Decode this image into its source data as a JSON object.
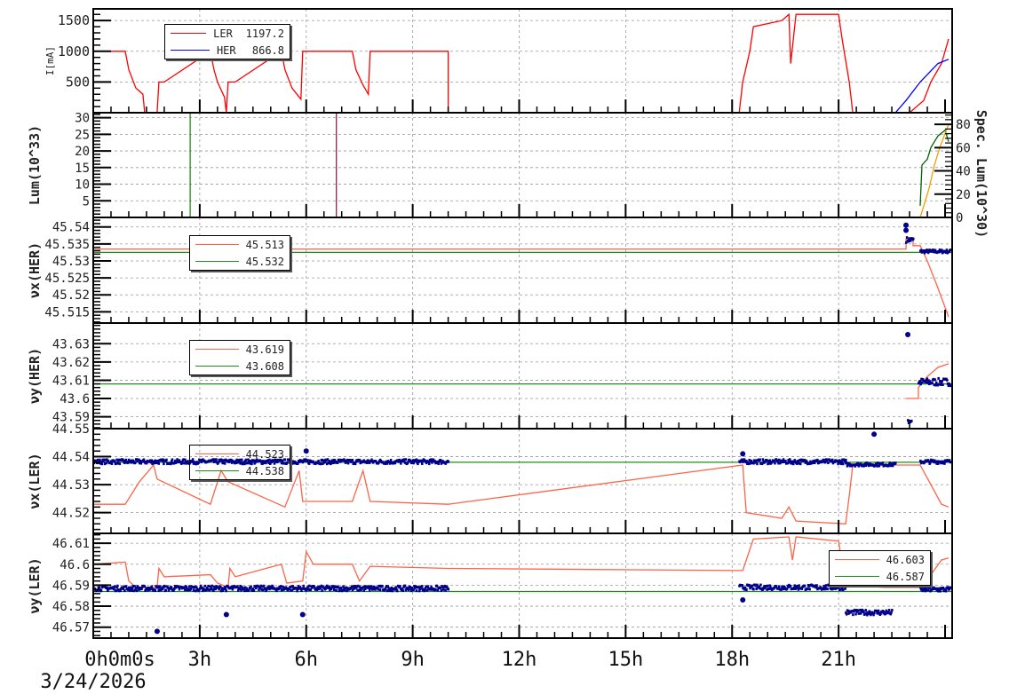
{
  "chart_data": [
    {
      "id": "current",
      "type": "line",
      "ylabel": "I[mA]",
      "ylim": [
        0,
        1690
      ],
      "yticks": [
        500,
        1000,
        1500
      ],
      "legend": [
        {
          "name": "LER",
          "value": "1197.2",
          "color": "#ff0000"
        },
        {
          "name": "HER",
          "value": "866.8",
          "color": "#0000ff"
        }
      ],
      "series": [
        {
          "name": "LER",
          "color": "#ff0000",
          "points": [
            [
              0,
              1000
            ],
            [
              0.9,
              1000
            ],
            [
              1.0,
              700
            ],
            [
              1.2,
              400
            ],
            [
              1.4,
              300
            ],
            [
              1.45,
              0
            ],
            [
              1.8,
              0
            ],
            [
              1.85,
              500
            ],
            [
              2.0,
              500
            ],
            [
              3.3,
              1000
            ],
            [
              3.4,
              700
            ],
            [
              3.5,
              500
            ],
            [
              3.7,
              250
            ],
            [
              3.75,
              0
            ],
            [
              3.8,
              500
            ],
            [
              4.0,
              500
            ],
            [
              5.3,
              1000
            ],
            [
              5.4,
              700
            ],
            [
              5.6,
              400
            ],
            [
              5.85,
              220
            ],
            [
              5.9,
              1000
            ],
            [
              7.3,
              1000
            ],
            [
              7.4,
              700
            ],
            [
              7.6,
              450
            ],
            [
              7.75,
              300
            ],
            [
              7.8,
              1000
            ],
            [
              10.0,
              1000
            ],
            [
              10.0,
              0
            ],
            [
              18.2,
              0
            ],
            [
              18.3,
              500
            ],
            [
              18.5,
              1000
            ],
            [
              18.6,
              1400
            ],
            [
              19.4,
              1500
            ],
            [
              19.6,
              1600
            ],
            [
              19.65,
              800
            ],
            [
              19.8,
              1600
            ],
            [
              21.0,
              1600
            ],
            [
              21.1,
              1200
            ],
            [
              21.3,
              500
            ],
            [
              21.4,
              0
            ],
            [
              23.0,
              0
            ],
            [
              23.4,
              200
            ],
            [
              23.6,
              500
            ],
            [
              23.9,
              800
            ],
            [
              24.1,
              1200
            ]
          ]
        },
        {
          "name": "HER",
          "color": "#0000ff",
          "points": [
            [
              0,
              0
            ],
            [
              22.6,
              0
            ],
            [
              22.9,
              200
            ],
            [
              23.3,
              500
            ],
            [
              23.8,
              800
            ],
            [
              24.1,
              870
            ]
          ]
        }
      ]
    },
    {
      "id": "lum",
      "type": "line",
      "ylabel": "Lum(10^33)",
      "ylim": [
        0,
        31.5
      ],
      "yticks": [
        5,
        10,
        15,
        20,
        25,
        30
      ],
      "y2label": "Spec. Lum(10^30)",
      "y2lim": [
        0,
        90
      ],
      "y2ticks": [
        0,
        20,
        40,
        60,
        80
      ],
      "series": [
        {
          "name": "Lum spike",
          "color": "#228b22",
          "points": [
            [
              2.73,
              0
            ],
            [
              2.73,
              31.5
            ]
          ]
        },
        {
          "name": "Lum spike 2",
          "color": "#8b2252",
          "points": [
            [
              6.85,
              0
            ],
            [
              6.85,
              31.5
            ]
          ]
        },
        {
          "name": "Spec lum HER",
          "axis": "y2",
          "color": "#006400",
          "points": [
            [
              23.3,
              10
            ],
            [
              23.35,
              45
            ],
            [
              23.5,
              50
            ],
            [
              23.6,
              60
            ],
            [
              23.8,
              70
            ],
            [
              24.0,
              75
            ],
            [
              24.1,
              65
            ]
          ]
        },
        {
          "name": "Spec lum LER",
          "axis": "y2",
          "color": "#f0a000",
          "points": [
            [
              23.3,
              0
            ],
            [
              23.4,
              10
            ],
            [
              23.55,
              25
            ],
            [
              23.7,
              45
            ],
            [
              23.85,
              60
            ],
            [
              24.0,
              72
            ],
            [
              24.1,
              80
            ]
          ]
        }
      ]
    },
    {
      "id": "nux_her",
      "type": "line",
      "ylabel": "νx(HER)",
      "ylim": [
        45.5117,
        45.5428
      ],
      "yticks": [
        45.515,
        45.52,
        45.525,
        45.53,
        45.535,
        45.54
      ],
      "legend": [
        {
          "value": "45.513",
          "color": "#ff6347"
        },
        {
          "value": "45.532",
          "color": "#228b22"
        }
      ],
      "series": [
        {
          "name": "set",
          "color": "#ff6347",
          "points": [
            [
              0,
              45.5335
            ],
            [
              22.9,
              45.5335
            ],
            [
              22.9,
              45.5365
            ],
            [
              23.1,
              45.5365
            ],
            [
              23.1,
              45.5345
            ],
            [
              23.3,
              45.5345
            ],
            [
              23.5,
              45.53
            ],
            [
              23.8,
              45.522
            ],
            [
              24.1,
              45.5135
            ]
          ]
        },
        {
          "name": "ref",
          "color": "#228b22",
          "points": [
            [
              0,
              45.5325
            ],
            [
              24.2,
              45.5325
            ]
          ]
        }
      ],
      "dots": [
        [
          22.9,
          23.1,
          45.5362,
          0.0008
        ],
        [
          23.3,
          24.15,
          45.5328,
          0.0005
        ]
      ],
      "extra_dots": [
        [
          22.9,
          45.5405
        ],
        [
          22.9,
          45.539
        ]
      ]
    },
    {
      "id": "nuy_her",
      "type": "line",
      "ylabel": "νy(HER)",
      "ylim": [
        43.5835,
        43.6413
      ],
      "yticks": [
        43.59,
        43.6,
        43.61,
        43.62,
        43.63
      ],
      "legend": [
        {
          "value": "43.619",
          "color": "#ff6347"
        },
        {
          "value": "43.608",
          "color": "#228b22"
        }
      ],
      "series": [
        {
          "name": "set",
          "color": "#ff6347",
          "points": [
            [
              22.9,
              43.6
            ],
            [
              23.25,
              43.6
            ],
            [
              23.25,
              43.606
            ],
            [
              23.5,
              43.612
            ],
            [
              23.8,
              43.617
            ],
            [
              24.1,
              43.619
            ]
          ]
        },
        {
          "name": "ref",
          "color": "#228b22",
          "points": [
            [
              0,
              43.608
            ],
            [
              24.2,
              43.608
            ]
          ]
        }
      ],
      "dots": [
        [
          22.95,
          23.05,
          43.588,
          0.002
        ],
        [
          23.25,
          24.15,
          43.609,
          0.002
        ]
      ],
      "extra_dots": [
        [
          22.95,
          43.635
        ]
      ]
    },
    {
      "id": "nux_ler",
      "type": "line",
      "ylabel": "νx(LER)",
      "ylim": [
        44.5126,
        44.55
      ],
      "yticks": [
        44.52,
        44.53,
        44.54,
        44.55
      ],
      "legend": [
        {
          "value": "44.523",
          "color": "#ff6347"
        },
        {
          "value": "44.538",
          "color": "#228b22"
        }
      ],
      "series": [
        {
          "name": "set",
          "color": "#ff6347",
          "points": [
            [
              0,
              44.523
            ],
            [
              0.9,
              44.523
            ],
            [
              1.3,
              44.531
            ],
            [
              1.7,
              44.537
            ],
            [
              1.8,
              44.532
            ],
            [
              3.3,
              44.523
            ],
            [
              3.6,
              44.535
            ],
            [
              3.8,
              44.531
            ],
            [
              5.4,
              44.522
            ],
            [
              5.8,
              44.535
            ],
            [
              5.9,
              44.524
            ],
            [
              7.3,
              44.524
            ],
            [
              7.6,
              44.535
            ],
            [
              7.8,
              44.524
            ],
            [
              10,
              44.523
            ],
            [
              18.3,
              44.537
            ],
            [
              18.4,
              44.52
            ],
            [
              19.4,
              44.518
            ],
            [
              19.6,
              44.522
            ],
            [
              19.8,
              44.517
            ],
            [
              21.2,
              44.516
            ],
            [
              21.3,
              44.526
            ],
            [
              21.4,
              44.537
            ],
            [
              23.3,
              44.537
            ],
            [
              23.6,
              44.53
            ],
            [
              23.9,
              44.523
            ],
            [
              24.1,
              44.522
            ]
          ]
        },
        {
          "name": "ref",
          "color": "#228b22",
          "points": [
            [
              0,
              44.538
            ],
            [
              24.2,
              44.538
            ]
          ]
        }
      ],
      "dots": [
        [
          0,
          10,
          44.5382,
          0.0008
        ],
        [
          18.2,
          21.2,
          44.5382,
          0.0008
        ],
        [
          21.2,
          22.6,
          44.5372,
          0.0006
        ],
        [
          23.3,
          24.15,
          44.5382,
          0.0007
        ]
      ],
      "extra_dots": [
        [
          6.0,
          44.542
        ],
        [
          18.3,
          44.541
        ],
        [
          22.0,
          44.548
        ]
      ]
    },
    {
      "id": "nuy_ler",
      "type": "line",
      "ylabel": "νy(LER)",
      "ylim": [
        46.5648,
        46.6147
      ],
      "yticks": [
        46.57,
        46.58,
        46.59,
        46.6,
        46.61
      ],
      "legend": [
        {
          "value": "46.603",
          "color": "#ff6347"
        },
        {
          "value": "46.587",
          "color": "#228b22"
        }
      ],
      "series": [
        {
          "name": "set",
          "color": "#ff6347",
          "points": [
            [
              0,
              46.6
            ],
            [
              0.9,
              46.601
            ],
            [
              1.0,
              46.592
            ],
            [
              1.2,
              46.589
            ],
            [
              1.8,
              46.589
            ],
            [
              1.85,
              46.598
            ],
            [
              2.0,
              46.594
            ],
            [
              3.3,
              46.595
            ],
            [
              3.5,
              46.591
            ],
            [
              3.8,
              46.589
            ],
            [
              3.85,
              46.598
            ],
            [
              4.0,
              46.594
            ],
            [
              5.3,
              46.6
            ],
            [
              5.45,
              46.591
            ],
            [
              5.9,
              46.592
            ],
            [
              6.0,
              46.606
            ],
            [
              6.2,
              46.6
            ],
            [
              7.3,
              46.6
            ],
            [
              7.5,
              46.592
            ],
            [
              7.8,
              46.599
            ],
            [
              10,
              46.598
            ],
            [
              18.3,
              46.597
            ],
            [
              18.6,
              46.612
            ],
            [
              19.6,
              46.613
            ],
            [
              19.7,
              46.602
            ],
            [
              19.8,
              46.613
            ],
            [
              21.0,
              46.611
            ],
            [
              21.2,
              46.59
            ],
            [
              22.3,
              46.589
            ],
            [
              23.3,
              46.589
            ],
            [
              23.6,
              46.595
            ],
            [
              23.9,
              46.602
            ],
            [
              24.1,
              46.603
            ]
          ]
        },
        {
          "name": "ref",
          "color": "#228b22",
          "points": [
            [
              0,
              46.587
            ],
            [
              24.2,
              46.587
            ]
          ]
        }
      ],
      "dots": [
        [
          0,
          10,
          46.5885,
          0.0012
        ],
        [
          18.2,
          21.2,
          46.589,
          0.0012
        ],
        [
          21.2,
          22.5,
          46.577,
          0.0012
        ],
        [
          23.3,
          24.15,
          46.588,
          0.0012
        ]
      ],
      "extra_dots": [
        [
          1.8,
          46.568
        ],
        [
          3.75,
          46.576
        ],
        [
          5.9,
          46.576
        ],
        [
          18.3,
          46.583
        ]
      ]
    }
  ],
  "xaxis": {
    "ticks": [
      0,
      3,
      6,
      9,
      12,
      15,
      18,
      21
    ],
    "labels": [
      "0h0m0s",
      "3h",
      "6h",
      "9h",
      "12h",
      "15h",
      "18h",
      "21h"
    ],
    "date": "3/24/2026",
    "xlim": [
      0,
      24.2
    ]
  }
}
